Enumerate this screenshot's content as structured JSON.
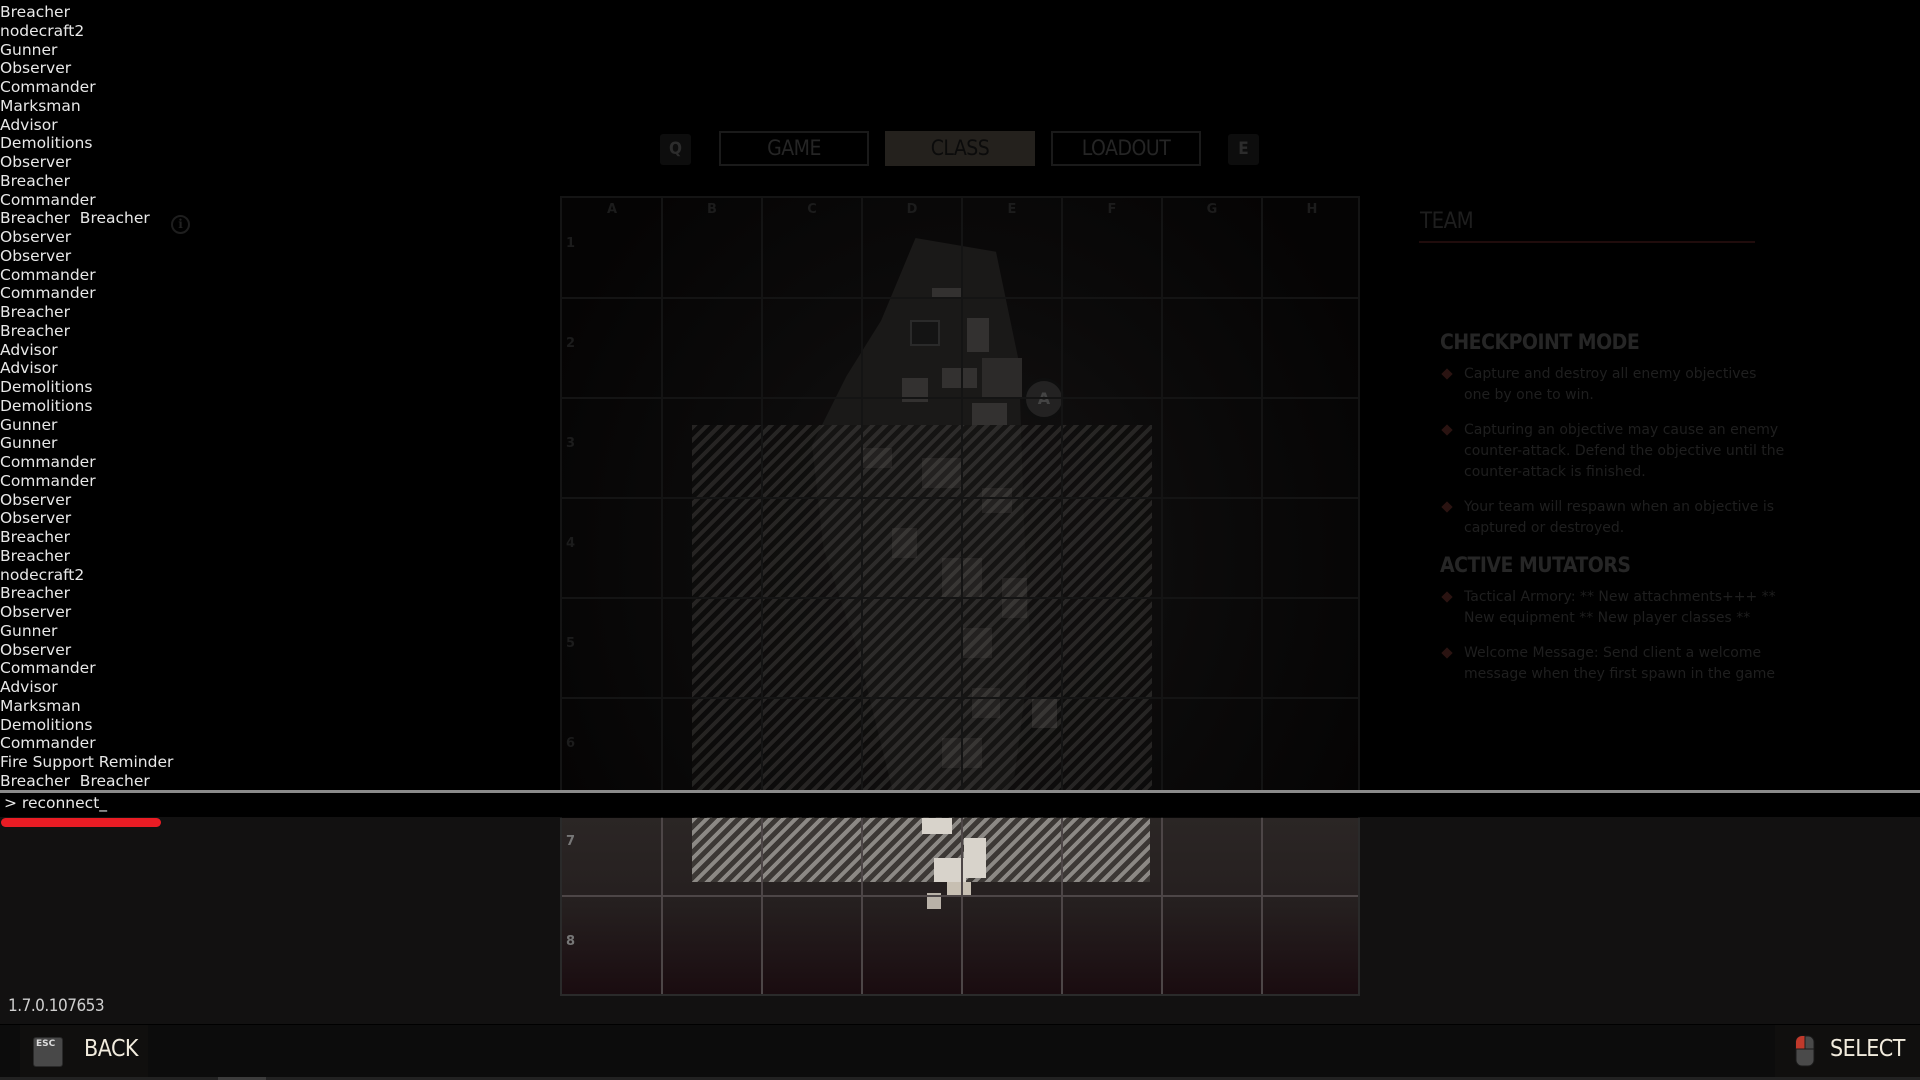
{
  "console": {
    "log_lines": [
      "Breacher",
      "nodecraft2",
      "Gunner",
      "Observer",
      "Commander",
      "Marksman",
      "Advisor",
      "Demolitions",
      "Observer",
      "Breacher",
      "Commander",
      "Breacher  Breacher",
      "Observer",
      "Observer",
      "Commander",
      "Commander",
      "Breacher",
      "Breacher",
      "Advisor",
      "Advisor",
      "Demolitions",
      "Demolitions",
      "Gunner",
      "Gunner",
      "Commander",
      "Commander",
      "Observer",
      "Observer",
      "Breacher",
      "Breacher",
      "nodecraft2",
      "Breacher",
      "Observer",
      "Gunner",
      "Observer",
      "Commander",
      "Advisor",
      "Marksman",
      "Demolitions",
      "Commander",
      "Fire Support Reminder",
      "Breacher  Breacher"
    ],
    "input_value": "> reconnect_",
    "info_icon": "info-icon"
  },
  "tabs": {
    "prev_key": "Q",
    "next_key": "E",
    "items": [
      {
        "label": "GAME",
        "active": false
      },
      {
        "label": "CLASS",
        "active": true
      },
      {
        "label": "LOADOUT",
        "active": false
      }
    ]
  },
  "map": {
    "columns": [
      "A",
      "B",
      "C",
      "D",
      "E",
      "F",
      "G",
      "H"
    ],
    "rows": [
      "1",
      "2",
      "3",
      "4",
      "5",
      "6",
      "7",
      "8"
    ],
    "objective_label": "A"
  },
  "team_panel": {
    "title": "TEAM",
    "mode_title": "CHECKPOINT MODE",
    "mode_bullets": [
      "Capture and destroy all enemy objectives one by one to win.",
      "Capturing an objective may cause an enemy counter-attack. Defend the objective until the counter-attack is finished.",
      "Your team will respawn when an objective is captured or destroyed."
    ],
    "mutators_title": "ACTIVE MUTATORS",
    "mutator_bullets": [
      "Tactical Armory: ** New attachments+++ ** New equipment ** New player classes **",
      "Welcome Message: Send client a welcome message when they first spawn in the game"
    ],
    "accent_color": "#2a1311"
  },
  "footer": {
    "version": "1.7.0.107653",
    "back_key": "ESC",
    "back_label": "BACK",
    "select_label": "SELECT"
  },
  "colors": {
    "console_text": "#e8e8e8",
    "console_underline": "#e81c24",
    "button_text": "#f1ebdd",
    "mouse_button_highlight": "#c0392b"
  }
}
